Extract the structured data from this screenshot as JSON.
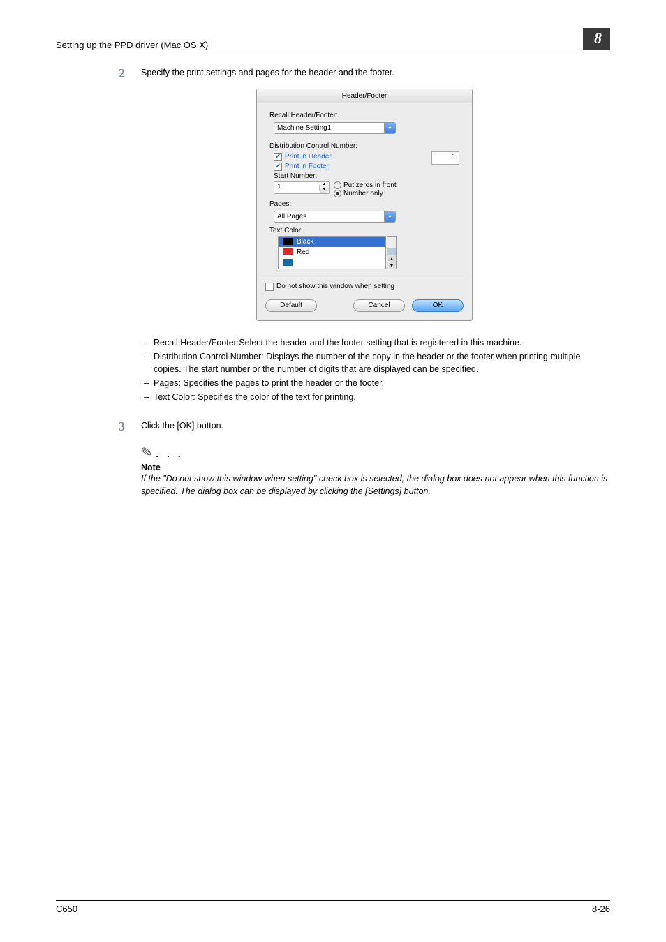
{
  "header": {
    "left": "Setting up the PPD driver (Mac OS X)",
    "badge": "8"
  },
  "steps": {
    "s2": {
      "num": "2",
      "text": "Specify the print settings and pages for the header and the footer."
    },
    "s3": {
      "num": "3",
      "text": "Click the [OK] button."
    }
  },
  "dialog": {
    "title": "Header/Footer",
    "recall_label": "Recall Header/Footer:",
    "recall_value": "Machine Setting1",
    "dcn_label": "Distribution Control Number:",
    "print_header": "Print in Header",
    "print_footer": "Print in Footer",
    "digits_value": "1",
    "start_label": "Start Number:",
    "start_value": "1",
    "put_zeros": "Put zeros in front",
    "number_only": "Number only",
    "pages_label": "Pages:",
    "pages_value": "All Pages",
    "textcolor_label": "Text Color:",
    "color_black": "Black",
    "color_red": "Red",
    "noshow": "Do not show this window when setting",
    "btn_default": "Default",
    "btn_cancel": "Cancel",
    "btn_ok": "OK"
  },
  "bullets": {
    "b1": "Recall Header/Footer:Select the header and the footer setting that is registered in this machine.",
    "b2": "Distribution Control Number: Displays the number of the copy in the header or the footer when printing multiple copies. The start number or the number of digits that are displayed can be specified.",
    "b3": "Pages: Specifies the pages to print the header or the footer.",
    "b4": "Text Color: Specifies the color of the text for printing."
  },
  "note": {
    "dots": ". . .",
    "label": "Note",
    "text": "If the \"Do not show this window when setting\" check box is selected, the dialog box does not appear when this function is specified. The dialog box can be displayed by clicking the [Settings] button."
  },
  "footer": {
    "left": "C650",
    "right": "8-26"
  },
  "colors": {
    "black": "#000000",
    "red": "#d6292a"
  }
}
